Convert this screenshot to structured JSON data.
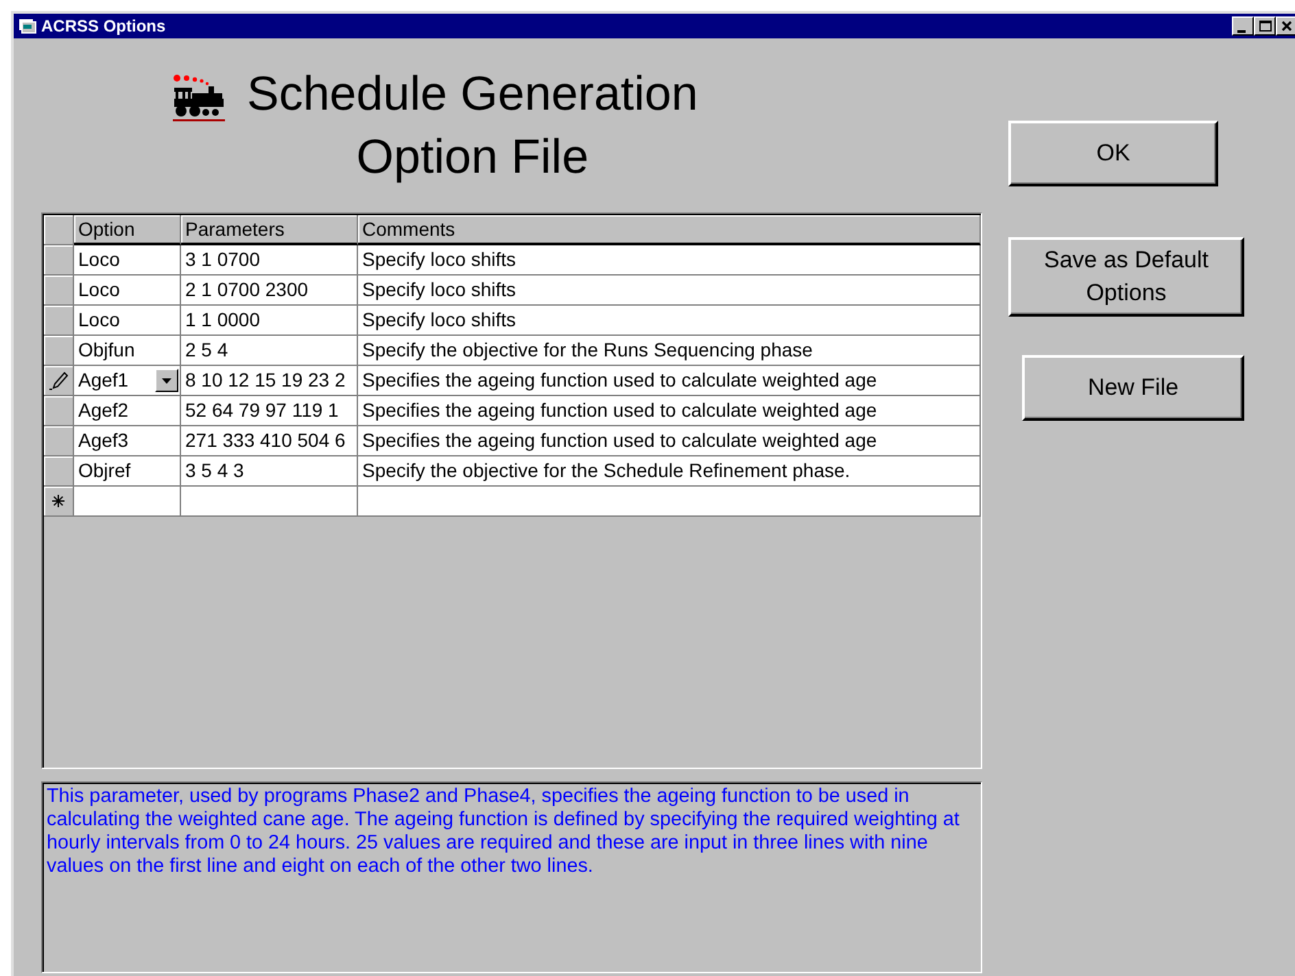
{
  "window": {
    "title": "ACRSS Options"
  },
  "heading": [
    "Schedule Generation",
    "Option File"
  ],
  "table": {
    "columns": [
      "Option",
      "Parameters",
      "Comments"
    ],
    "rows": [
      {
        "kind": "data",
        "editing": false,
        "cells": [
          "Loco",
          "3 1 0700",
          "Specify loco shifts"
        ]
      },
      {
        "kind": "data",
        "editing": false,
        "cells": [
          "Loco",
          "2 1 0700 2300",
          "Specify loco shifts"
        ]
      },
      {
        "kind": "data",
        "editing": false,
        "cells": [
          "Loco",
          "1 1 0000",
          "Specify loco shifts"
        ]
      },
      {
        "kind": "data",
        "editing": false,
        "cells": [
          "Objfun",
          "2 5 4",
          "Specify the objective for the Runs Sequencing phase"
        ]
      },
      {
        "kind": "data",
        "editing": true,
        "cells": [
          "Agef1",
          "8 10 12 15 19 23 2",
          "Specifies the ageing function used to calculate weighted age"
        ]
      },
      {
        "kind": "data",
        "editing": false,
        "cells": [
          "Agef2",
          "52 64 79 97 119 1",
          "Specifies the ageing function used to calculate weighted age"
        ]
      },
      {
        "kind": "data",
        "editing": false,
        "cells": [
          "Agef3",
          "271 333 410 504 6",
          "Specifies the ageing function used to calculate weighted age"
        ]
      },
      {
        "kind": "data",
        "editing": false,
        "cells": [
          "Objref",
          "3 5 4 3",
          "Specify the objective for the Schedule Refinement phase."
        ]
      },
      {
        "kind": "new"
      }
    ]
  },
  "description": "This parameter, used by programs Phase2 and Phase4, specifies the ageing function to be used in calculating the weighted cane age.  The ageing function is defined by specifying the required weighting at hourly intervals from 0 to 24 hours.  25 values are required and these are input in three lines with nine values on the first line and eight on each of the other two lines.",
  "buttons": [
    "OK",
    "Save as Default Options",
    "New File"
  ]
}
